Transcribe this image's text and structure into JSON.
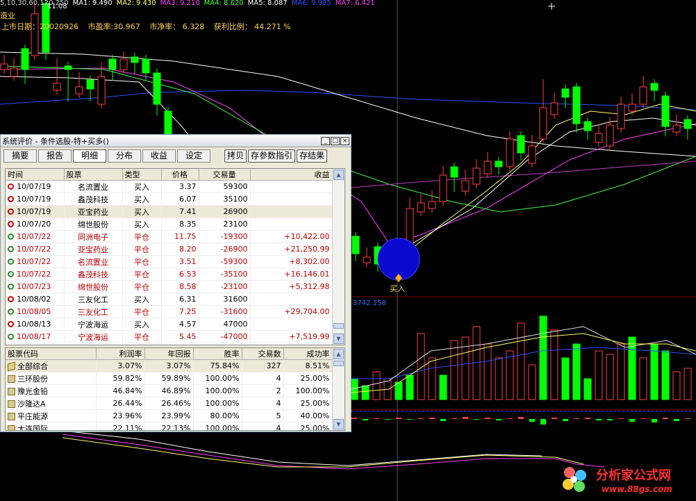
{
  "topbar": {
    "items": [
      "5,10,30,60,120,250",
      "MA1: 9.490",
      "MA2: 9.430",
      "MA3: 9.210",
      "MA4: 8.620",
      "MA5: 8.087",
      "MA6: 9.985",
      "MA7: 6.421"
    ]
  },
  "stock_title": "造业",
  "high_label": "11.08",
  "info": {
    "list_date_label": "上市日期：",
    "list_date": "20020926",
    "pe": "市盈率:30.967",
    "pb": "市净率： 6.328",
    "profit_ratio": "获利比例： 44.271 %"
  },
  "buy_marker": "买入",
  "indicator_value": "3742.158",
  "window": {
    "title": "系统评价 - 条件选股-特+买多()",
    "tabs": [
      "摘要",
      "报告",
      "明细",
      "分布",
      "收益",
      "设定"
    ],
    "active_tab": "明细",
    "buttons": [
      "拷贝",
      "存参数指引",
      "存结果"
    ],
    "trades_columns": [
      "时间",
      "股票",
      "类型",
      "价格",
      "交易量",
      "收益"
    ],
    "trades": [
      {
        "time": "10/07/19",
        "stock": "名流置业",
        "type": "买入",
        "price": "3.37",
        "volume": "59300",
        "profit": "",
        "red": false
      },
      {
        "time": "10/07/19",
        "stock": "鑫茂科技",
        "type": "买入",
        "price": "6.07",
        "volume": "35100",
        "profit": "",
        "red": false
      },
      {
        "time": "10/07/19",
        "stock": "亚宝药业",
        "type": "买入",
        "price": "7.41",
        "volume": "26900",
        "profit": "",
        "red": false,
        "selected": true
      },
      {
        "time": "10/07/20",
        "stock": "绵世股份",
        "type": "买入",
        "price": "8.35",
        "volume": "23100",
        "profit": "",
        "red": false
      },
      {
        "time": "10/07/22",
        "stock": "同洲电子",
        "type": "平仓",
        "price": "11.75",
        "volume": "-19300",
        "profit": "+10,422.00",
        "red": true
      },
      {
        "time": "10/07/22",
        "stock": "亚宝药业",
        "type": "平仓",
        "price": "8.20",
        "volume": "-26900",
        "profit": "+21,250.99",
        "red": true
      },
      {
        "time": "10/07/22",
        "stock": "名流置业",
        "type": "平仓",
        "price": "3.51",
        "volume": "-59300",
        "profit": "+8,302.00",
        "red": true
      },
      {
        "time": "10/07/22",
        "stock": "鑫茂科技",
        "type": "平仓",
        "price": "6.53",
        "volume": "-35100",
        "profit": "+16,146.01",
        "red": true
      },
      {
        "time": "10/07/23",
        "stock": "绵世股份",
        "type": "平仓",
        "price": "8.58",
        "volume": "-23100",
        "profit": "+5,312.98",
        "red": true
      },
      {
        "time": "10/08/02",
        "stock": "三友化工",
        "type": "买入",
        "price": "6.31",
        "volume": "31600",
        "profit": "",
        "red": false
      },
      {
        "time": "10/08/05",
        "stock": "三友化工",
        "type": "平仓",
        "price": "7.25",
        "volume": "-31600",
        "profit": "+29,704.00",
        "red": true
      },
      {
        "time": "10/08/13",
        "stock": "宁波海运",
        "type": "买入",
        "price": "4.57",
        "volume": "47000",
        "profit": "",
        "red": false
      },
      {
        "time": "10/08/17",
        "stock": "宁波海运",
        "type": "平仓",
        "price": "5.45",
        "volume": "-47000",
        "profit": "+7,519.99",
        "red": true
      }
    ],
    "summary_columns": [
      "股票代码",
      "利润率",
      "年回报",
      "胜率",
      "交易数",
      "成功率"
    ],
    "summary": [
      {
        "name": "全部综合",
        "profit_rate": "3.07%",
        "annual": "3.07%",
        "win": "75.84%",
        "trades": "327",
        "success": "8.51%",
        "all": true
      },
      {
        "name": "三环股份",
        "profit_rate": "59.82%",
        "annual": "59.89%",
        "win": "100.00%",
        "trades": "4",
        "success": "25.00%"
      },
      {
        "name": "豫光金铅",
        "profit_rate": "46.84%",
        "annual": "46.89%",
        "win": "100.00%",
        "trades": "2",
        "success": "100.00%"
      },
      {
        "name": "沙隆达A",
        "profit_rate": "26.44%",
        "annual": "26.46%",
        "win": "100.00%",
        "trades": "4",
        "success": "25.00%"
      },
      {
        "name": "平庄能源",
        "profit_rate": "23.96%",
        "annual": "23.99%",
        "win": "80.00%",
        "trades": "5",
        "success": "40.00%"
      },
      {
        "name": "大连国际",
        "profit_rate": "22.11%",
        "annual": "22.13%",
        "win": "100.00%",
        "trades": "4",
        "success": "25.00%"
      }
    ]
  },
  "watermark": {
    "title": "分析家公式网",
    "url": "www.88gs.com"
  },
  "colors": {
    "up": "#ff4040",
    "down": "#00ff00",
    "ma_white": "#ffffff",
    "ma_yellow": "#ffff66",
    "ma_magenta": "#ff40ff",
    "ma_green": "#40ff40",
    "ma_blue": "#3050ff",
    "ma_purple": "#c040c0"
  }
}
